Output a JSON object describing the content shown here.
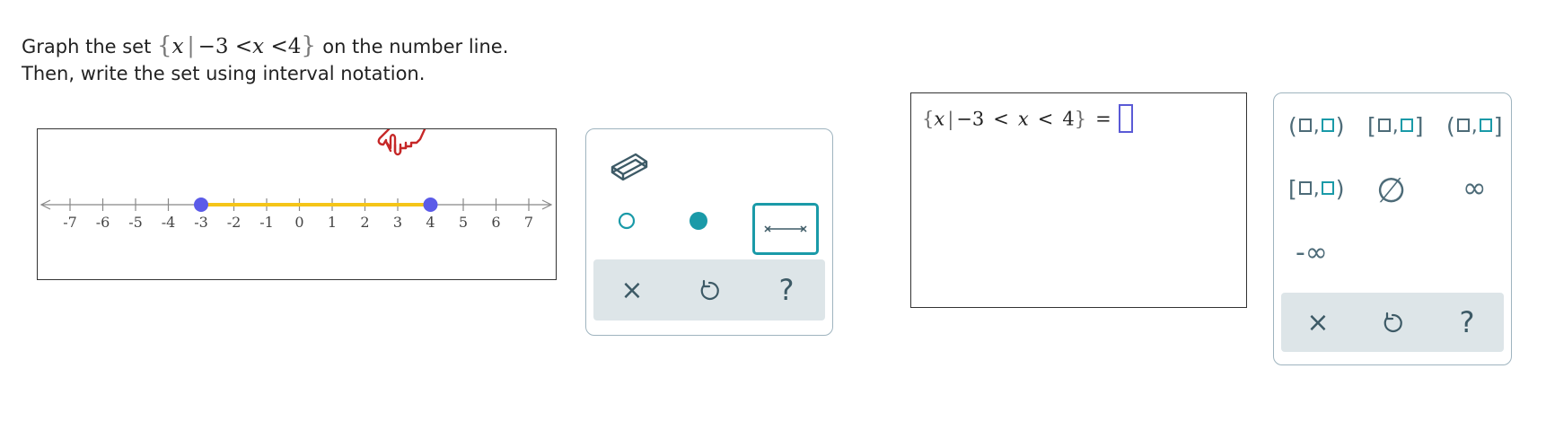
{
  "prompt": {
    "line1_prefix": "Graph the set",
    "set_var": "x",
    "set_bar": "|",
    "set_lower": "−3",
    "set_lt1": "<",
    "set_var2": "x",
    "set_lt2": "<",
    "set_upper": "4",
    "line1_suffix": "on the number line.",
    "line2": "Then, write the set using interval notation."
  },
  "number_line": {
    "ticks": [
      "-7",
      "-6",
      "-5",
      "-4",
      "-3",
      "-2",
      "-1",
      "0",
      "1",
      "2",
      "3",
      "4",
      "5",
      "6",
      "7"
    ],
    "segment_start": -3,
    "segment_end": 4,
    "segment_color": "#f5c518",
    "endpoint_color": "#5b5be8",
    "cursor_color": "#c62828"
  },
  "tools": {
    "eraser": "eraser-icon",
    "open_point": "open-circle",
    "closed_point": "closed-circle",
    "segment": "segment-tool",
    "accent": "#1a9aa8",
    "clear_label": "×",
    "undo_icon": "undo-icon",
    "help_label": "?"
  },
  "answer": {
    "lbrace": "{",
    "var": "x",
    "bar": "|",
    "lower": "−3",
    "lt1": "<",
    "var2": "x",
    "lt2": "<",
    "upper": "4",
    "rbrace": "}",
    "eq": "="
  },
  "keypad": {
    "keys": {
      "open_open": {
        "l": "(",
        "c": ",",
        "r": ")"
      },
      "closed_closed": {
        "l": "[",
        "c": ",",
        "r": "]"
      },
      "open_closed": {
        "l": "(",
        "c": ",",
        "r": "]"
      },
      "closed_open": {
        "l": "[",
        "c": ",",
        "r": ")"
      },
      "empty_set": "∅",
      "infinity": "∞",
      "neg_infinity": "-∞"
    },
    "clear_label": "×",
    "undo_icon": "undo-icon",
    "help_label": "?"
  }
}
